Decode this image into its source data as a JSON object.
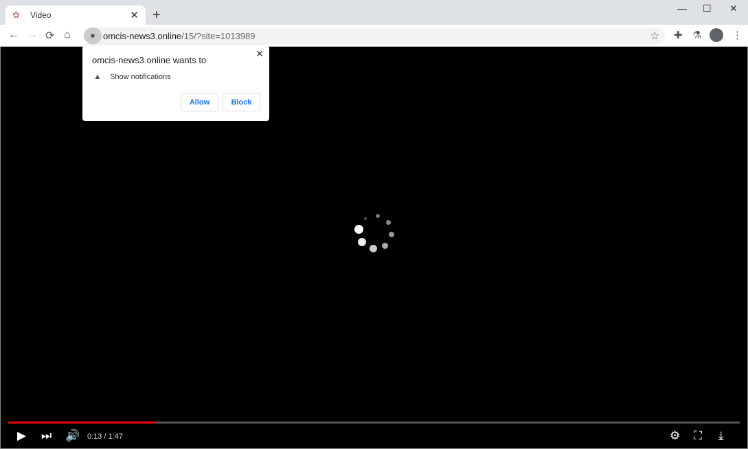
{
  "browser": {
    "tab_title": "Video",
    "url_host": "omcis-news3.online",
    "url_path": "/15/?site=1013989"
  },
  "icons": {
    "close": "✕",
    "new_tab": "+",
    "minimize": "—",
    "maximize": "☐",
    "back": "←",
    "forward": "→",
    "reload": "⟳",
    "home": "⌂",
    "lock": "🔒",
    "star": "☆",
    "extensions": "✚",
    "labs": "⚗",
    "menu": "⋮",
    "bell": "🔔",
    "play": "▶",
    "next": "⏭",
    "volume": "🔊",
    "settings": "⚙",
    "fullscreen": "⛶",
    "download": "⤓"
  },
  "popup": {
    "title": "omcis-news3.online wants to",
    "permission": "Show notifications",
    "allow": "Allow",
    "block": "Block"
  },
  "player": {
    "time": "0:13 / 1:47",
    "played_fraction": 0.2
  }
}
